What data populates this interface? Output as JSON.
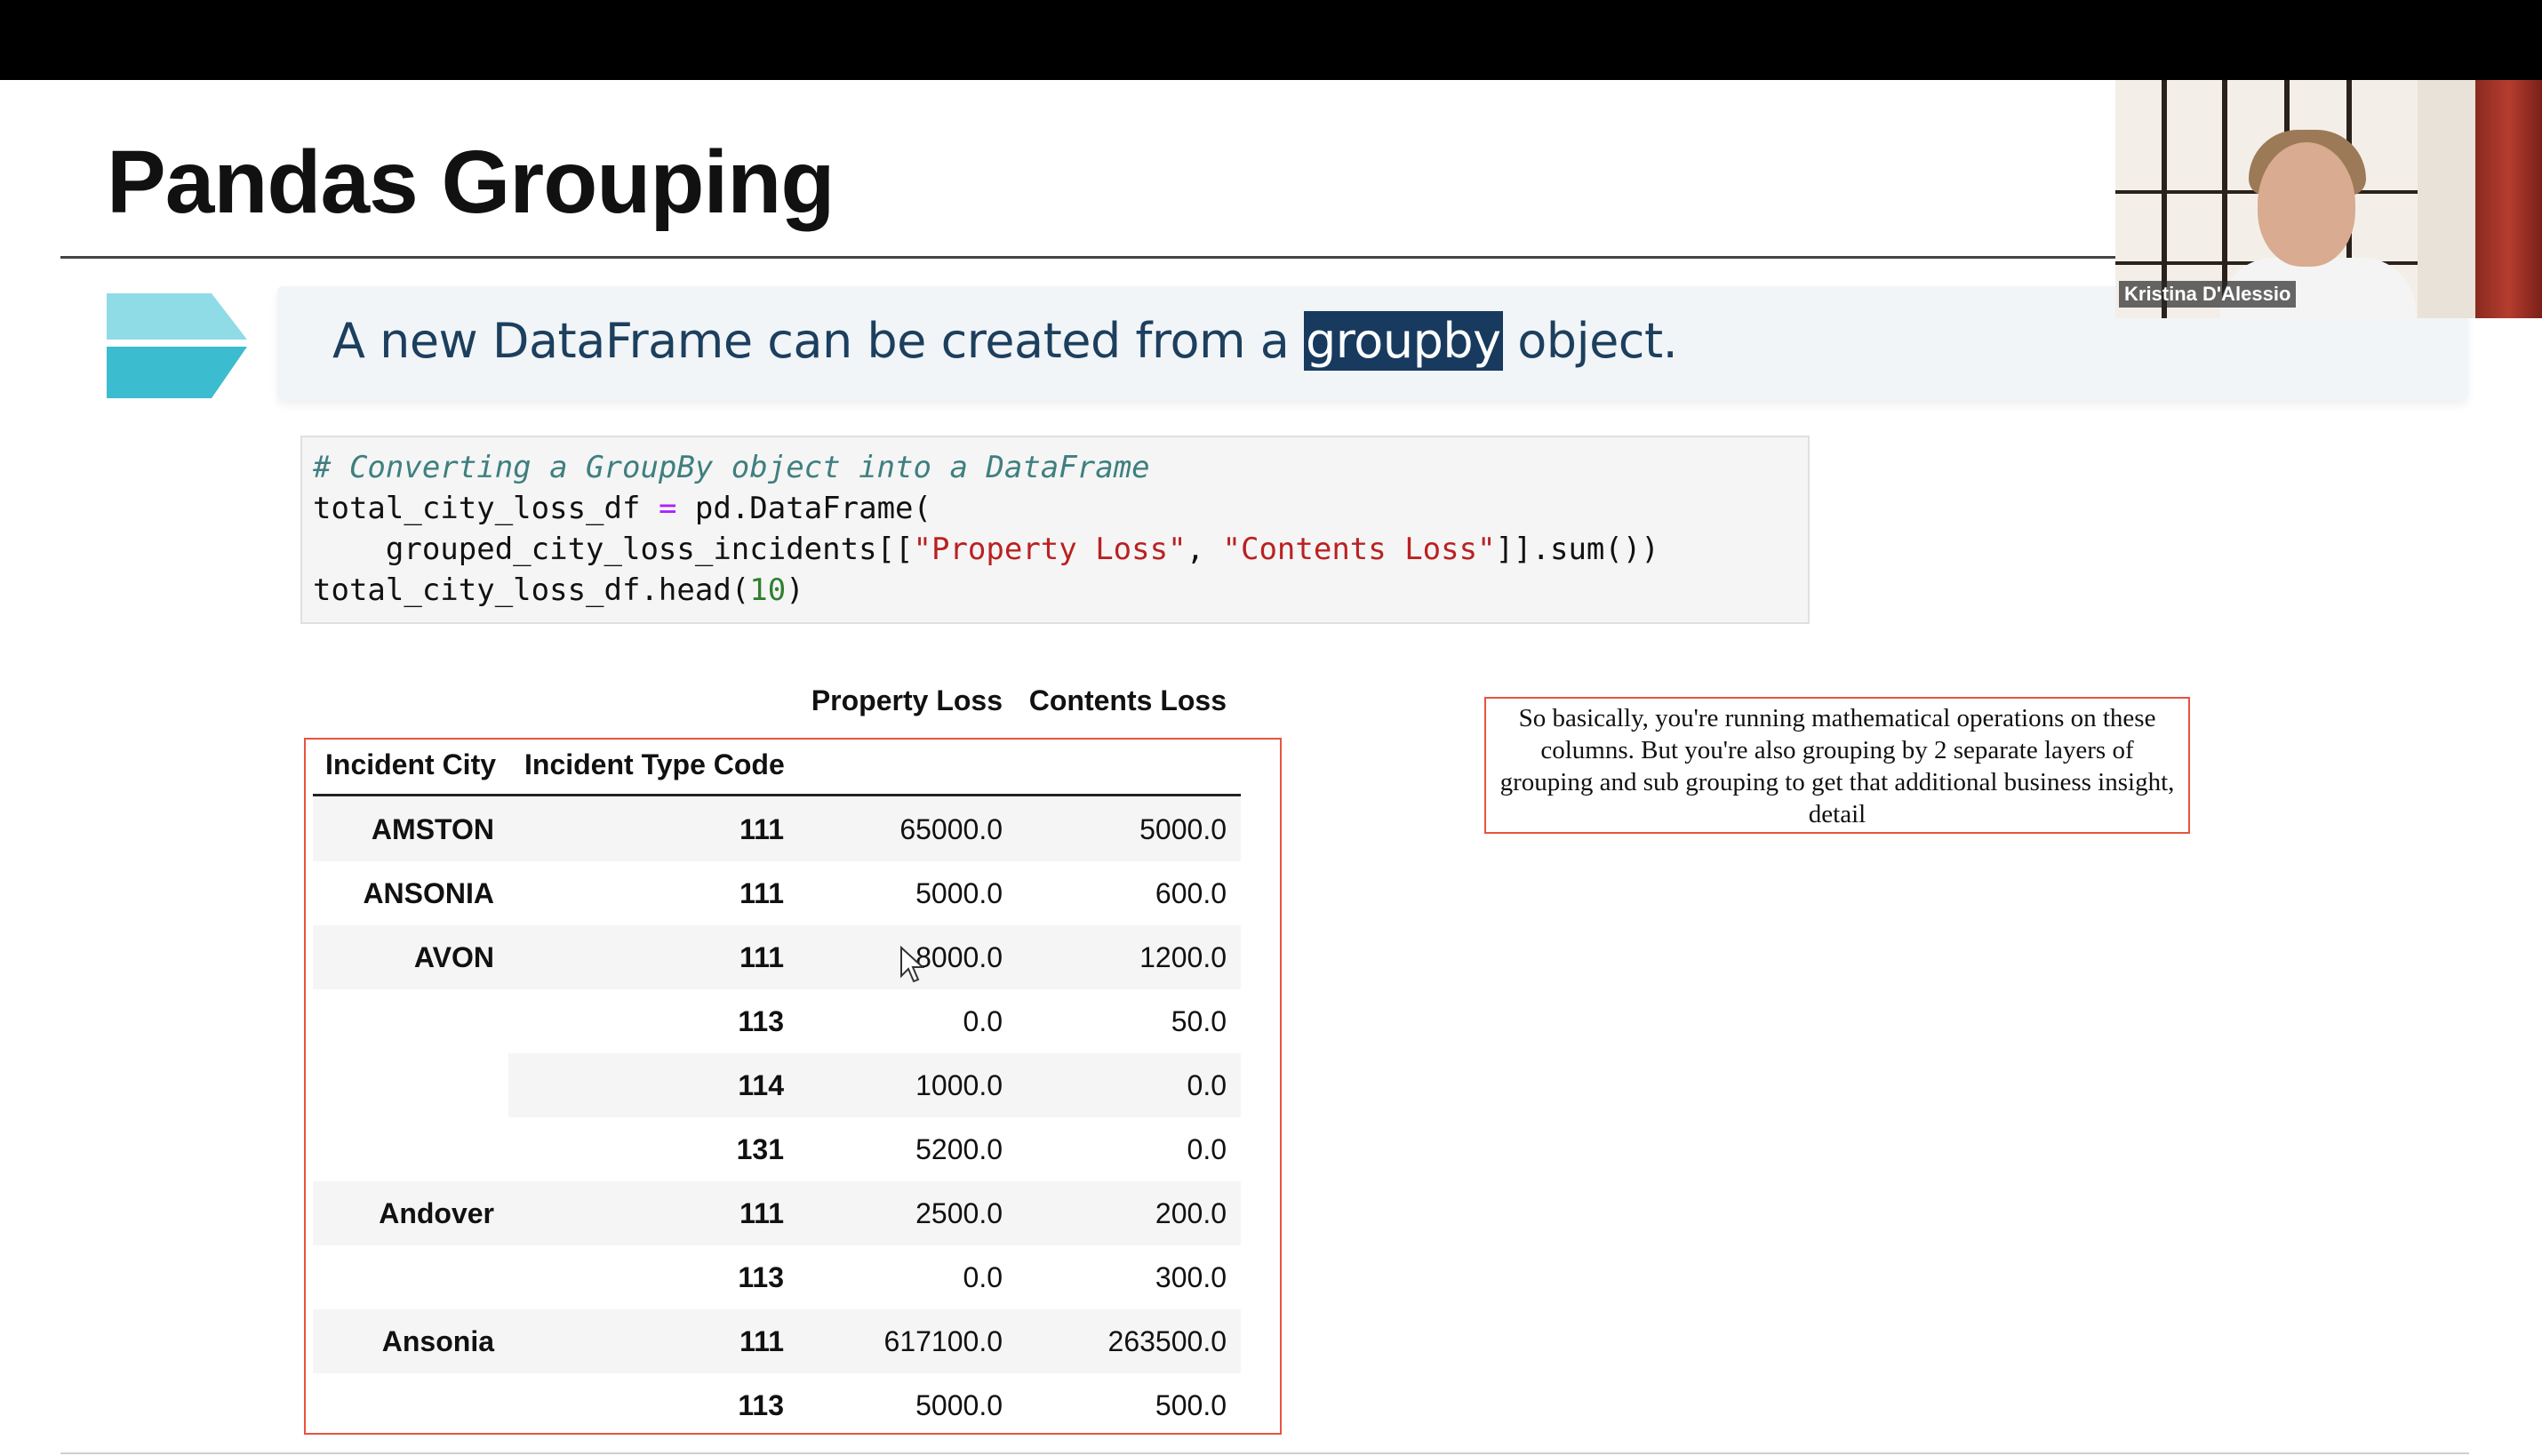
{
  "slide": {
    "title": "Pandas Grouping",
    "banner_text_before": "A new DataFrame can be created from a ",
    "banner_text_highlight": "groupby",
    "banner_text_after": " object."
  },
  "code": {
    "line1": "# Converting a GroupBy object into a DataFrame",
    "line2_a": "total_city_loss_df ",
    "line2_op": "=",
    "line2_b": " pd.DataFrame(",
    "line3_a": "    grouped_city_loss_incidents[[",
    "line3_s1": "\"Property Loss\"",
    "line3_c": ", ",
    "line3_s2": "\"Contents Loss\"",
    "line3_b": "]].sum())",
    "line4_a": "total_city_loss_df.head(",
    "line4_num": "10",
    "line4_b": ")"
  },
  "dataframe": {
    "columns": [
      "Property Loss",
      "Contents Loss"
    ],
    "index_names": [
      "Incident City",
      "Incident Type Code"
    ],
    "rows": [
      {
        "city": "AMSTON",
        "code": "111",
        "property": "65000.0",
        "contents": "5000.0"
      },
      {
        "city": "ANSONIA",
        "code": "111",
        "property": "5000.0",
        "contents": "600.0"
      },
      {
        "city": "AVON",
        "code": "111",
        "property": "8000.0",
        "contents": "1200.0"
      },
      {
        "city": "",
        "code": "113",
        "property": "0.0",
        "contents": "50.0"
      },
      {
        "city": "",
        "code": "114",
        "property": "1000.0",
        "contents": "0.0"
      },
      {
        "city": "",
        "code": "131",
        "property": "5200.0",
        "contents": "0.0"
      },
      {
        "city": "Andover",
        "code": "111",
        "property": "2500.0",
        "contents": "200.0"
      },
      {
        "city": "",
        "code": "113",
        "property": "0.0",
        "contents": "300.0"
      },
      {
        "city": "Ansonia",
        "code": "111",
        "property": "617100.0",
        "contents": "263500.0"
      },
      {
        "city": "",
        "code": "113",
        "property": "5000.0",
        "contents": "500.0"
      }
    ]
  },
  "note": {
    "text": "So basically, you're running mathematical operations on these columns. But you're also grouping by 2 separate layers of grouping and sub grouping to get that additional business insight, detail"
  },
  "webcam": {
    "participant_name": "Kristina D'Alessio"
  },
  "colors": {
    "banner_text": "#1d3f5e",
    "highlight_bg": "#173a5e",
    "arrow": "#4fc3d4",
    "outline": "#e8533f"
  }
}
